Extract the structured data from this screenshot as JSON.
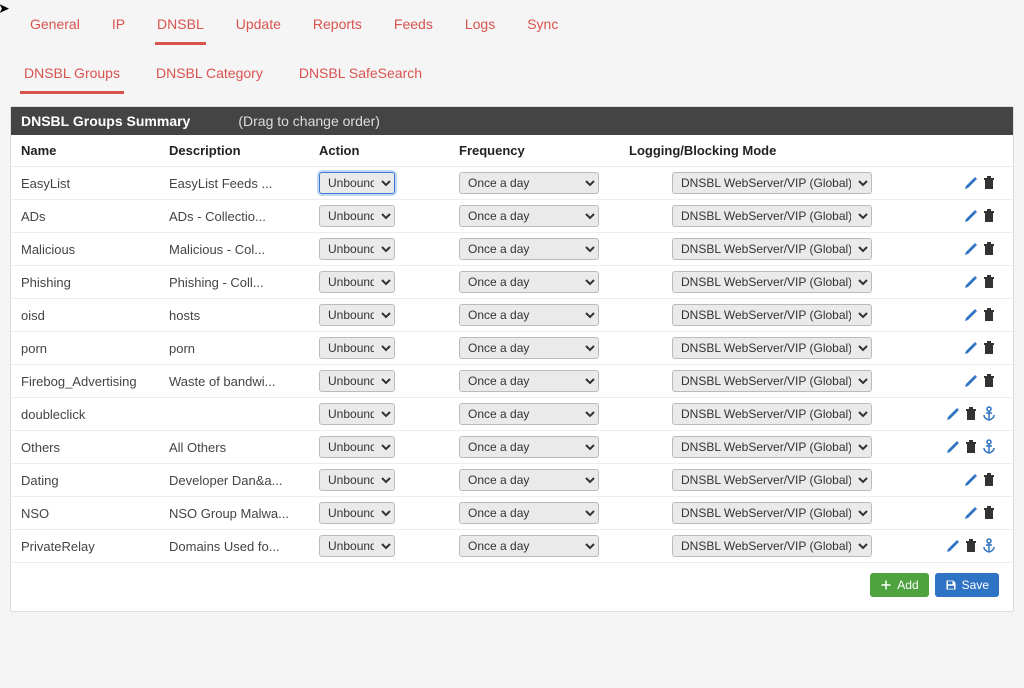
{
  "tabs": {
    "items": [
      "General",
      "IP",
      "DNSBL",
      "Update",
      "Reports",
      "Feeds",
      "Logs",
      "Sync"
    ],
    "active_index": 2
  },
  "subtabs": {
    "items": [
      "DNSBL Groups",
      "DNSBL Category",
      "DNSBL SafeSearch"
    ],
    "active_index": 0
  },
  "panel": {
    "title": "DNSBL Groups Summary",
    "hint": "(Drag to change order)"
  },
  "columns": [
    "Name",
    "Description",
    "Action",
    "Frequency",
    "Logging/Blocking Mode"
  ],
  "options": {
    "action": "Unbound",
    "frequency": "Once a day",
    "mode": "DNSBL WebServer/VIP (Global)"
  },
  "buttons": {
    "add": "Add",
    "save": "Save"
  },
  "rows": [
    {
      "name": "EasyList",
      "desc": "EasyList Feeds ...",
      "anchor": false
    },
    {
      "name": "ADs",
      "desc": "ADs - Collectio...",
      "anchor": false
    },
    {
      "name": "Malicious",
      "desc": "Malicious - Col...",
      "anchor": false
    },
    {
      "name": "Phishing",
      "desc": "Phishing - Coll...",
      "anchor": false
    },
    {
      "name": "oisd",
      "desc": "hosts",
      "anchor": false
    },
    {
      "name": "porn",
      "desc": "porn",
      "anchor": false
    },
    {
      "name": "Firebog_Advertising",
      "desc": "Waste of bandwi...",
      "anchor": false
    },
    {
      "name": "doubleclick",
      "desc": "",
      "anchor": true
    },
    {
      "name": "Others",
      "desc": "All Others",
      "anchor": true
    },
    {
      "name": "Dating",
      "desc": "Developer Dan&a...",
      "anchor": false
    },
    {
      "name": "NSO",
      "desc": "NSO Group Malwa...",
      "anchor": false
    },
    {
      "name": "PrivateRelay",
      "desc": "Domains Used fo...",
      "anchor": true
    }
  ]
}
